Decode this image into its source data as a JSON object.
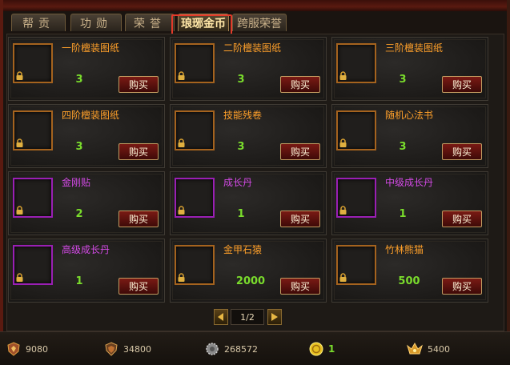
{
  "tabs": [
    {
      "label": "帮贡"
    },
    {
      "label": "功勋"
    },
    {
      "label": "荣誉"
    },
    {
      "label": "琅琊金币"
    },
    {
      "label": "跨服荣誉"
    }
  ],
  "items": [
    {
      "name": "一阶檀装图纸",
      "qty": "3",
      "buy": "购买",
      "quality": "orange"
    },
    {
      "name": "二阶檀装图纸",
      "qty": "3",
      "buy": "购买",
      "quality": "orange"
    },
    {
      "name": "三阶檀装图纸",
      "qty": "3",
      "buy": "购买",
      "quality": "orange"
    },
    {
      "name": "四阶檀装图纸",
      "qty": "3",
      "buy": "购买",
      "quality": "orange"
    },
    {
      "name": "技能残卷",
      "qty": "3",
      "buy": "购买",
      "quality": "orange"
    },
    {
      "name": "随机心法书",
      "qty": "3",
      "buy": "购买",
      "quality": "orange"
    },
    {
      "name": "金刚贴",
      "qty": "2",
      "buy": "购买",
      "quality": "purple"
    },
    {
      "name": "成长丹",
      "qty": "1",
      "buy": "购买",
      "quality": "purple"
    },
    {
      "name": "中级成长丹",
      "qty": "1",
      "buy": "购买",
      "quality": "purple"
    },
    {
      "name": "高级成长丹",
      "qty": "1",
      "buy": "购买",
      "quality": "purple"
    },
    {
      "name": "金甲石猿",
      "qty": "2000",
      "buy": "购买",
      "quality": "orange"
    },
    {
      "name": "竹林熊猫",
      "qty": "500",
      "buy": "购买",
      "quality": "orange"
    }
  ],
  "pager": {
    "text": "1/2"
  },
  "currencies": [
    {
      "icon": "guild-contribution-icon",
      "value": "9080"
    },
    {
      "icon": "merit-shield-icon",
      "value": "34800"
    },
    {
      "icon": "honor-gear-icon",
      "value": "268572"
    },
    {
      "icon": "langya-gold-coin-icon",
      "value": "1"
    },
    {
      "icon": "cross-server-honor-icon",
      "value": "5400"
    }
  ],
  "colors": {
    "orange_quality": "#a5631e",
    "purple_quality": "#9a1fb4",
    "qty_green": "#7adc2c",
    "active_tab_highlight": "#e23a2a"
  }
}
